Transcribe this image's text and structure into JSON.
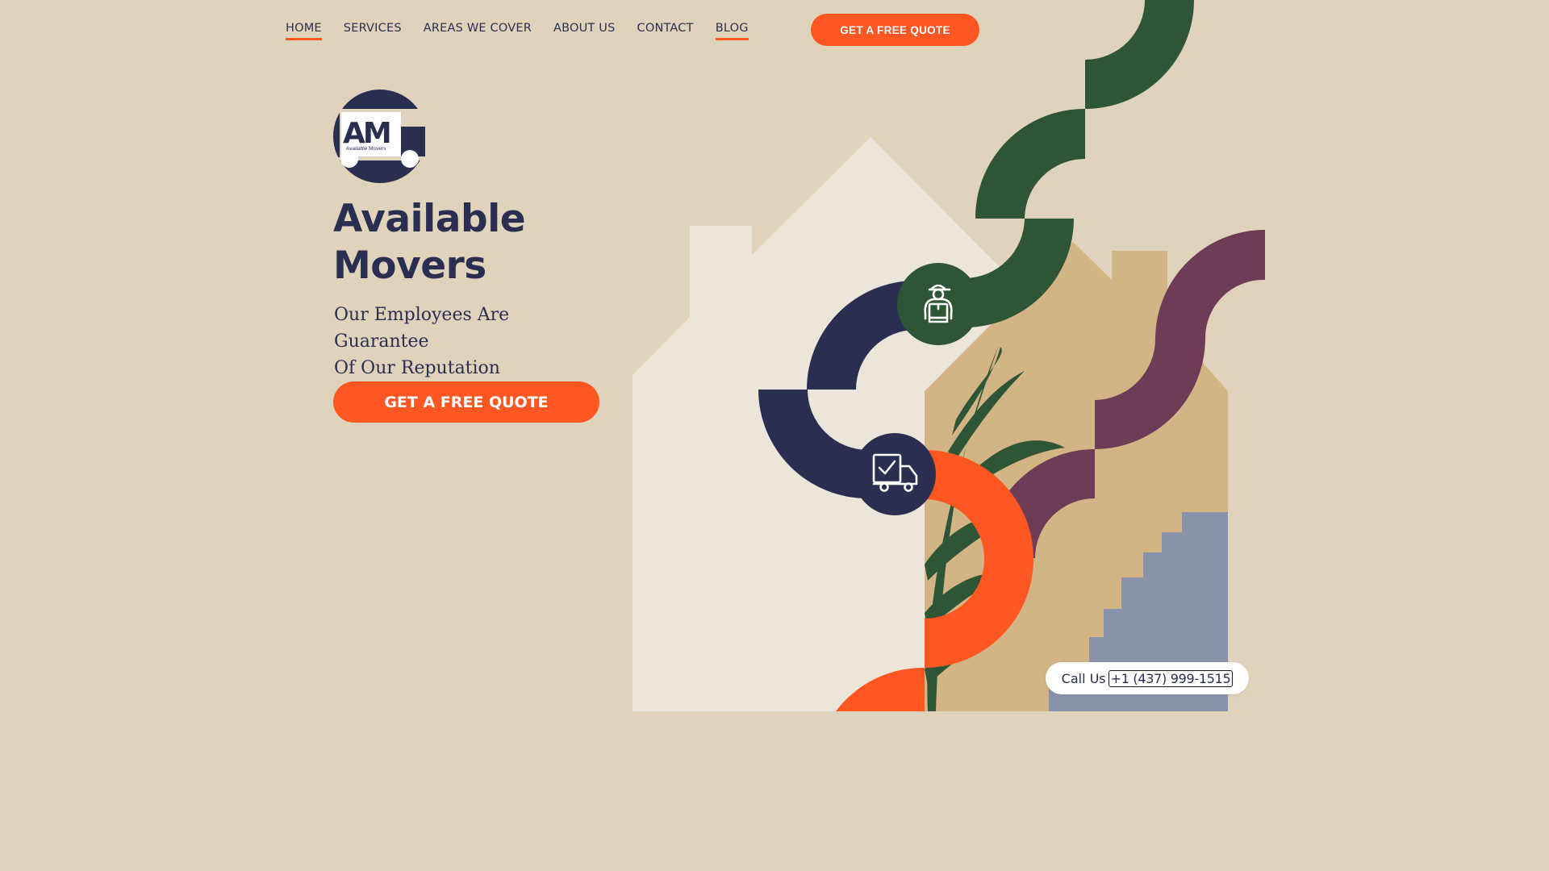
{
  "nav": {
    "items": [
      {
        "label": "HOME",
        "active": true
      },
      {
        "label": "SERVICES",
        "active": false
      },
      {
        "label": "AREAS WE COVER",
        "active": false
      },
      {
        "label": "ABOUT US",
        "active": false
      },
      {
        "label": "CONTACT",
        "active": false
      },
      {
        "label": "BLOG",
        "active": true
      }
    ],
    "cta_label": "GET A FREE QUOTE"
  },
  "logo": {
    "monogram": "AM",
    "wordmark": "Available Movers"
  },
  "hero": {
    "title_line1": "Available",
    "title_line2": "Movers",
    "subtitle_line1": "Our Employees Are Guarantee",
    "subtitle_line2": "Of Our Reputation",
    "cta_label": "GET A FREE QUOTE"
  },
  "call": {
    "label": "Call Us",
    "phone": "+1 (437) 999-1515"
  },
  "icons": [
    "mover-person-icon",
    "delivery-truck-check-icon"
  ],
  "colors": {
    "background": "#e0d3bb",
    "accent": "#ff5722",
    "navy": "#2a2f52",
    "green": "#2e5535",
    "plum": "#6e3c57",
    "house_light": "#ece5d9",
    "house_tan": "#d3b585",
    "stairs": "#8892ab"
  }
}
